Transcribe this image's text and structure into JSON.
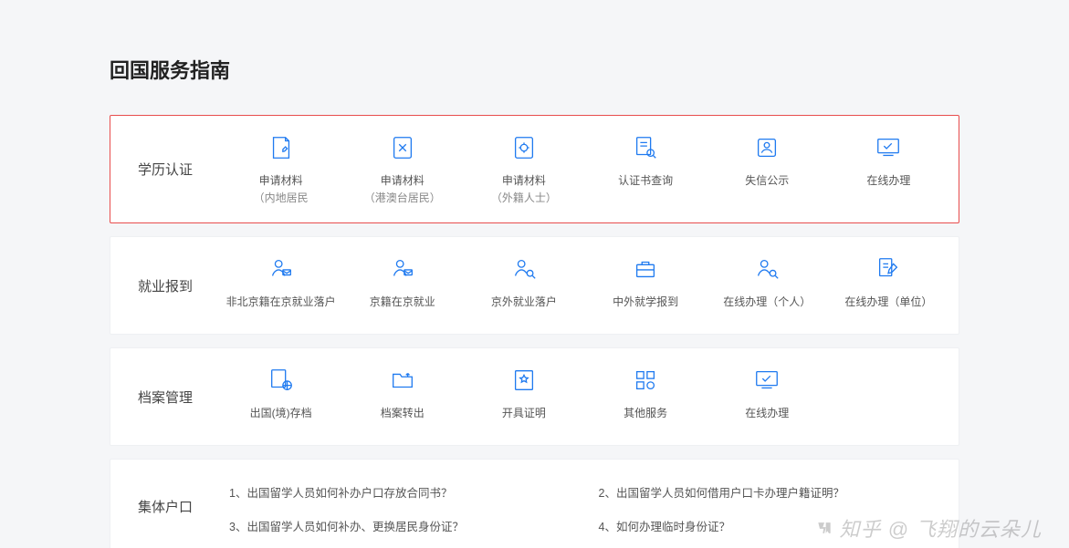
{
  "title": "回国服务指南",
  "rows": [
    {
      "id": "degree-auth",
      "label": "学历认证",
      "highlight": true,
      "items": [
        {
          "id": "apply-material-mainland",
          "label": "申请材料",
          "sublabel": "（内地居民",
          "icon": "doc-write"
        },
        {
          "id": "apply-material-ghmt",
          "label": "申请材料",
          "sublabel": "（港澳台居民）",
          "icon": "doc-edit"
        },
        {
          "id": "apply-material-foreign",
          "label": "申请材料",
          "sublabel": "（外籍人士）",
          "icon": "doc-gear"
        },
        {
          "id": "certificate-inquiry",
          "label": "认证书查询",
          "icon": "doc-search"
        },
        {
          "id": "discredit-publicity",
          "label": "失信公示",
          "icon": "person-card"
        },
        {
          "id": "online-process",
          "label": "在线办理",
          "icon": "monitor-check"
        }
      ]
    },
    {
      "id": "employment-report",
      "label": "就业报到",
      "highlight": false,
      "items": [
        {
          "id": "nonbj-in-bj-settle",
          "label": "非北京籍在京就业落户",
          "icon": "person-mail"
        },
        {
          "id": "bj-in-bj-work",
          "label": "京籍在京就业",
          "icon": "person-mail"
        },
        {
          "id": "nonbj-work-settle",
          "label": "京外就业落户",
          "icon": "person-search"
        },
        {
          "id": "cn-foreign-report",
          "label": "中外就学报到",
          "icon": "briefcase"
        },
        {
          "id": "online-personal",
          "label": "在线办理（个人）",
          "icon": "person-search"
        },
        {
          "id": "online-org",
          "label": "在线办理（单位）",
          "icon": "doc-pen"
        }
      ]
    },
    {
      "id": "archive-mgmt",
      "label": "档案管理",
      "highlight": false,
      "items": [
        {
          "id": "abroad-store",
          "label": "出国(境)存档",
          "icon": "doc-globe"
        },
        {
          "id": "archive-out",
          "label": "档案转出",
          "icon": "folder-out"
        },
        {
          "id": "issue-proof",
          "label": "开具证明",
          "icon": "doc-star"
        },
        {
          "id": "other-service",
          "label": "其他服务",
          "icon": "grid-plus"
        },
        {
          "id": "online-archive",
          "label": "在线办理",
          "icon": "monitor-check"
        },
        {
          "id": "empty",
          "label": "",
          "icon": "",
          "empty": true
        }
      ]
    }
  ],
  "faq": {
    "id": "collective-hukou",
    "label": "集体户口",
    "items": [
      "1、出国留学人员如何补办户口存放合同书？",
      "2、出国留学人员如何借用户口卡办理户籍证明？",
      "3、出国留学人员如何补办、更换居民身份证？",
      "4、如何办理临时身份证？"
    ]
  },
  "watermark": "知乎 @ 飞翔的云朵儿"
}
